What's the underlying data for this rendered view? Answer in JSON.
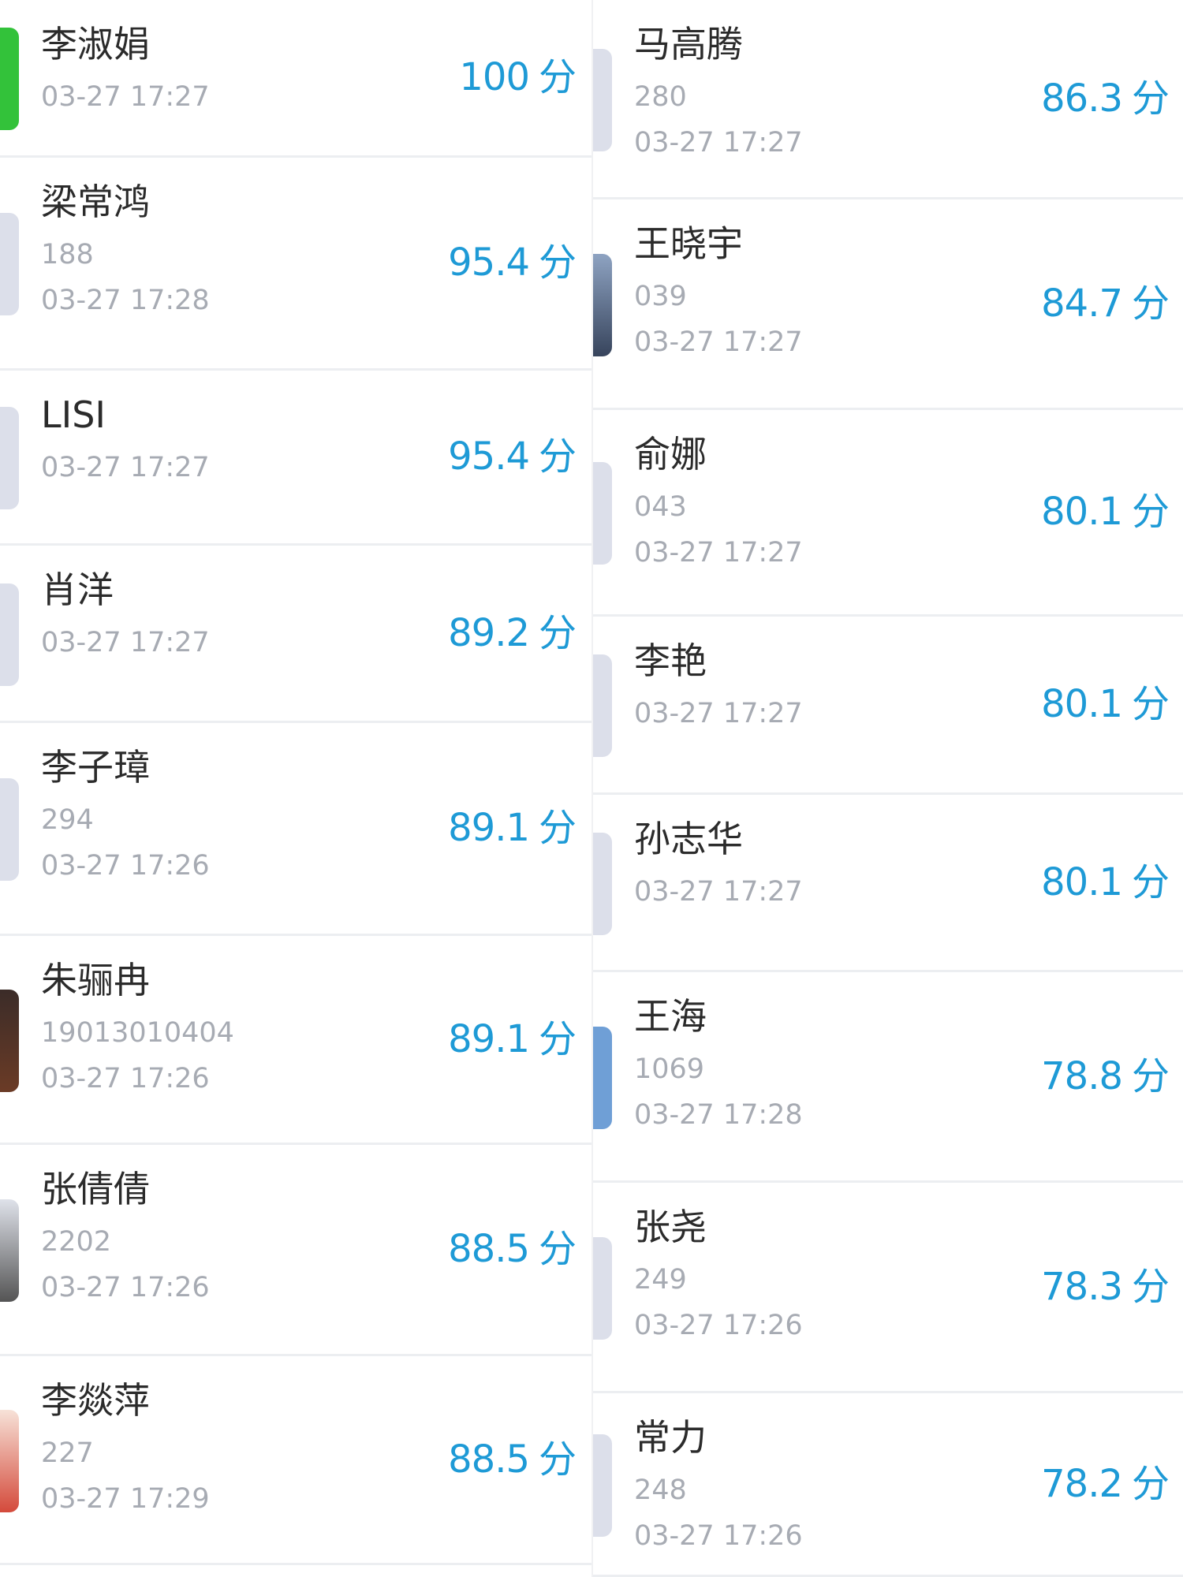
{
  "left_list": [
    {
      "name": "李淑娟",
      "id": "",
      "time": "03-27 17:27",
      "score": "100",
      "unit": "分",
      "avatar": "green-icon"
    },
    {
      "name": "梁常鸿",
      "id": "188",
      "time": "03-27 17:28",
      "score": "95.4",
      "unit": "分",
      "avatar": "default-avatar-icon"
    },
    {
      "name": "LISI",
      "id": "",
      "time": "03-27 17:27",
      "score": "95.4",
      "unit": "分",
      "avatar": "default-avatar-icon"
    },
    {
      "name": "肖洋",
      "id": "",
      "time": "03-27 17:27",
      "score": "89.2",
      "unit": "分",
      "avatar": "default-avatar-icon"
    },
    {
      "name": "李子璋",
      "id": "294",
      "time": "03-27 17:26",
      "score": "89.1",
      "unit": "分",
      "avatar": "default-avatar-icon"
    },
    {
      "name": "朱骊冉",
      "id": "19013010404",
      "time": "03-27 17:26",
      "score": "89.1",
      "unit": "分",
      "avatar": "photo-avatar-icon"
    },
    {
      "name": "张倩倩",
      "id": "2202",
      "time": "03-27 17:26",
      "score": "88.5",
      "unit": "分",
      "avatar": "photo-avatar-icon"
    },
    {
      "name": "李燚萍",
      "id": "227",
      "time": "03-27 17:29",
      "score": "88.5",
      "unit": "分",
      "avatar": "photo-avatar-icon"
    }
  ],
  "right_list": [
    {
      "name": "马高腾",
      "id": "280",
      "time": "03-27 17:27",
      "score": "86.3",
      "unit": "分",
      "avatar": "default-avatar-icon"
    },
    {
      "name": "王晓宇",
      "id": "039",
      "time": "03-27 17:27",
      "score": "84.7",
      "unit": "分",
      "avatar": "photo-avatar-icon"
    },
    {
      "name": "俞娜",
      "id": "043",
      "time": "03-27 17:27",
      "score": "80.1",
      "unit": "分",
      "avatar": "default-avatar-icon"
    },
    {
      "name": "李艳",
      "id": "",
      "time": "03-27 17:27",
      "score": "80.1",
      "unit": "分",
      "avatar": "default-avatar-icon"
    },
    {
      "name": "孙志华",
      "id": "",
      "time": "03-27 17:27",
      "score": "80.1",
      "unit": "分",
      "avatar": "default-avatar-icon"
    },
    {
      "name": "王海",
      "id": "1069",
      "time": "03-27 17:28",
      "score": "78.8",
      "unit": "分",
      "avatar": "blue-avatar-icon"
    },
    {
      "name": "张尧",
      "id": "249",
      "time": "03-27 17:26",
      "score": "78.3",
      "unit": "分",
      "avatar": "default-avatar-icon"
    },
    {
      "name": "常力",
      "id": "248",
      "time": "03-27 17:26",
      "score": "78.2",
      "unit": "分",
      "avatar": "default-avatar-icon"
    }
  ]
}
